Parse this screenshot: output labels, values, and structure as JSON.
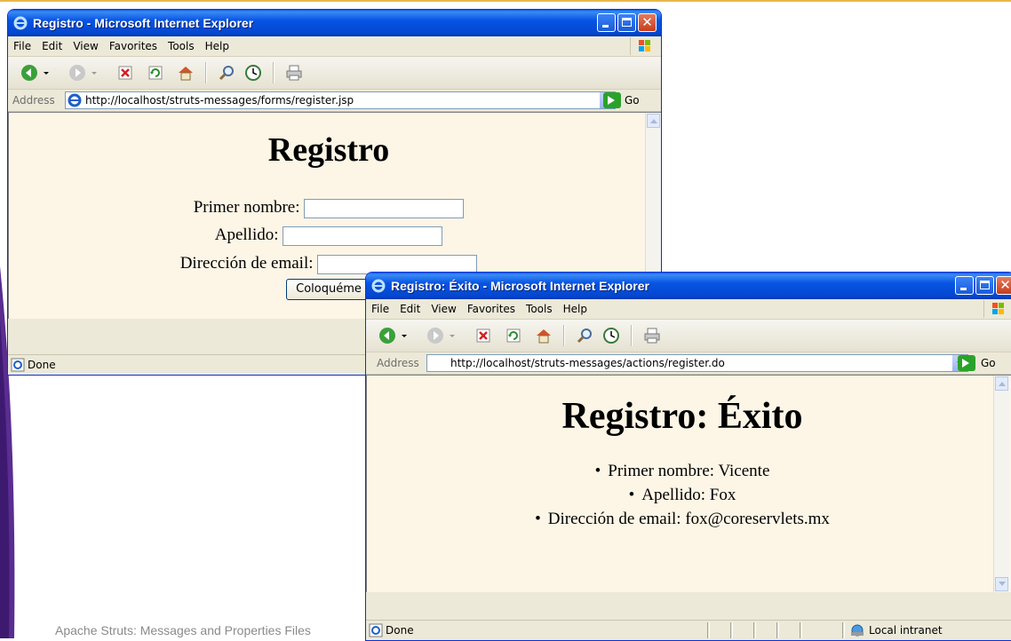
{
  "slide": {
    "footer": "Apache Struts: Messages and Properties Files"
  },
  "window1": {
    "title": "Registro - Microsoft Internet Explorer",
    "menu": [
      "File",
      "Edit",
      "View",
      "Favorites",
      "Tools",
      "Help"
    ],
    "address_label": "Address",
    "url": "http://localhost/struts-messages/forms/register.jsp",
    "go_label": "Go",
    "page": {
      "heading": "Registro",
      "first_name_label": "Primer nombre:",
      "last_name_label": "Apellido:",
      "email_label": "Dirección de email:",
      "submit_label": "Coloquéme"
    },
    "status": "Done"
  },
  "window2": {
    "title": "Registro: Éxito - Microsoft Internet Explorer",
    "menu": [
      "File",
      "Edit",
      "View",
      "Favorites",
      "Tools",
      "Help"
    ],
    "address_label": "Address",
    "url": "http://localhost/struts-messages/actions/register.do",
    "go_label": "Go",
    "page": {
      "heading": "Registro: Éxito",
      "items": [
        "Primer nombre: Vicente",
        "Apellido: Fox",
        "Dirección de email: fox@coreservlets.mx"
      ]
    },
    "status": "Done",
    "zone": "Local intranet"
  },
  "colors": {
    "xp_title_blue": "#0754e3",
    "page_background": "#fdf5e6",
    "chrome": "#ece9d8",
    "slide_accent": "#5a2d91"
  },
  "icons": {
    "toolbar": [
      "back-icon",
      "forward-icon",
      "stop-icon",
      "refresh-icon",
      "home-icon",
      "search-icon",
      "favorites-icon",
      "print-icon"
    ]
  }
}
